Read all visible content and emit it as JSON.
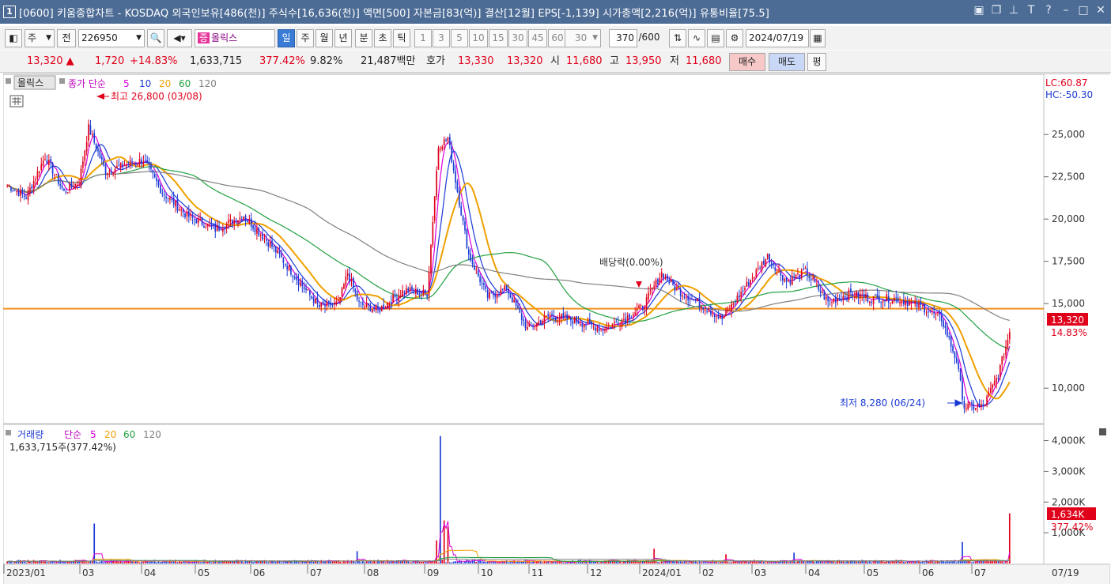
{
  "window": {
    "number": "1",
    "title": "[0600] 키움종합차트 - KOSDAQ 외국인보유[486(천)] 주식수[16,636(천)] 액면[500] 자본금[83(억)] 결산[12월] EPS[-1,139] 시가총액[2,216(억)] 유통비율[75.5]"
  },
  "toolbar": {
    "type_label": "주",
    "prev_label": "전",
    "code": "226950",
    "stock_name": "올릭스",
    "periods": [
      "일",
      "주",
      "월",
      "년",
      "분",
      "초",
      "틱"
    ],
    "active_period": "일",
    "intervals": [
      "1",
      "3",
      "5",
      "10",
      "15",
      "30",
      "45",
      "60"
    ],
    "interval_value": "30",
    "count": "370",
    "count_total": "/600",
    "date": "2024/07/19"
  },
  "quote": {
    "price": "13,320",
    "change": "1,720",
    "change_pct": "+14.83%",
    "volume": "1,633,715",
    "volume_pct": "377.42%",
    "turnover": "9.82%",
    "amount": "21,487백만",
    "hoga_label": "호가",
    "ask": "13,330",
    "bid": "13,320",
    "open_label": "시",
    "open": "11,680",
    "high_label": "고",
    "high": "13,950",
    "low_label": "저",
    "low": "11,680",
    "buy_label": "매수",
    "sell_label": "매도",
    "eval_label": "평"
  },
  "price_pane": {
    "stock_tag": "올릭스",
    "legend": {
      "label": "종가 단순",
      "ma": [
        "5",
        "10",
        "20",
        "60",
        "120"
      ]
    },
    "high_annotation": "최고 26,800 (03/08)",
    "low_annotation": "최저 8,280 (06/24)",
    "dividend_annotation": "배당락(0.00%)",
    "lc": "LC:60.87",
    "hc": "HC:-50.30",
    "price_tag": "13,320",
    "pct_tag": "14.83%"
  },
  "volume_pane": {
    "legend": {
      "label": "거래량",
      "avg": "단순",
      "ma": [
        "5",
        "20",
        "60",
        "120"
      ]
    },
    "current": "1,633,715주(377.42%)",
    "tag": "1,634K",
    "tag_pct": "377.42%"
  },
  "colors": {
    "up": "#e0001a",
    "down": "#1a3ad6",
    "ma5": "#d900d9",
    "ma10": "#1a3ad6",
    "ma20": "#f0a000",
    "ma60": "#20a040",
    "ma120": "#808080",
    "refline": "#f39020"
  },
  "chart_data": {
    "type": "candlestick",
    "x_labels": [
      "2023/01",
      "03",
      "04",
      "05",
      "06",
      "07",
      "08",
      "09",
      "10",
      "11",
      "12",
      "2024/01",
      "02",
      "03",
      "04",
      "05",
      "06",
      "07",
      "07/19"
    ],
    "price_ticks": [
      "25,000",
      "22,500",
      "20,000",
      "17,500",
      "15,000",
      "10,000"
    ],
    "price_range": [
      8000,
      28000
    ],
    "reference_price": 14700,
    "volume_ticks": [
      "4,000K",
      "3,000K",
      "2,000K",
      "1,000K"
    ],
    "volume_range": [
      0,
      4400
    ],
    "price_anchors": [
      [
        0,
        22000
      ],
      [
        10,
        21300
      ],
      [
        20,
        23700
      ],
      [
        30,
        21600
      ],
      [
        38,
        22200
      ],
      [
        43,
        25400
      ],
      [
        52,
        22800
      ],
      [
        62,
        23200
      ],
      [
        72,
        23500
      ],
      [
        82,
        21600
      ],
      [
        95,
        20200
      ],
      [
        110,
        19400
      ],
      [
        125,
        20200
      ],
      [
        140,
        18400
      ],
      [
        155,
        16200
      ],
      [
        165,
        14800
      ],
      [
        175,
        15000
      ],
      [
        180,
        16800
      ],
      [
        186,
        15000
      ],
      [
        196,
        14600
      ],
      [
        210,
        15800
      ],
      [
        222,
        15600
      ],
      [
        228,
        24300
      ],
      [
        233,
        24800
      ],
      [
        244,
        17900
      ],
      [
        254,
        15400
      ],
      [
        264,
        15900
      ],
      [
        275,
        13500
      ],
      [
        287,
        14300
      ],
      [
        300,
        14000
      ],
      [
        315,
        13500
      ],
      [
        326,
        14100
      ],
      [
        336,
        14800
      ],
      [
        346,
        16800
      ],
      [
        354,
        15800
      ],
      [
        366,
        15000
      ],
      [
        378,
        14100
      ],
      [
        391,
        16100
      ],
      [
        402,
        17800
      ],
      [
        412,
        16300
      ],
      [
        422,
        16900
      ],
      [
        434,
        15100
      ],
      [
        446,
        15600
      ],
      [
        456,
        15300
      ],
      [
        470,
        15300
      ],
      [
        484,
        14800
      ],
      [
        494,
        14100
      ],
      [
        502,
        11600
      ],
      [
        506,
        8900
      ],
      [
        516,
        8900
      ],
      [
        524,
        10800
      ],
      [
        530,
        13320
      ]
    ],
    "volume_spikes": [
      [
        46,
        1300
      ],
      [
        185,
        400
      ],
      [
        227,
        750
      ],
      [
        229,
        4150
      ],
      [
        231,
        1400
      ],
      [
        233,
        1200
      ],
      [
        342,
        480
      ],
      [
        380,
        300
      ],
      [
        416,
        350
      ],
      [
        505,
        700
      ],
      [
        530,
        1634
      ]
    ],
    "ma_periods": [
      5,
      10,
      20,
      60,
      120
    ]
  }
}
